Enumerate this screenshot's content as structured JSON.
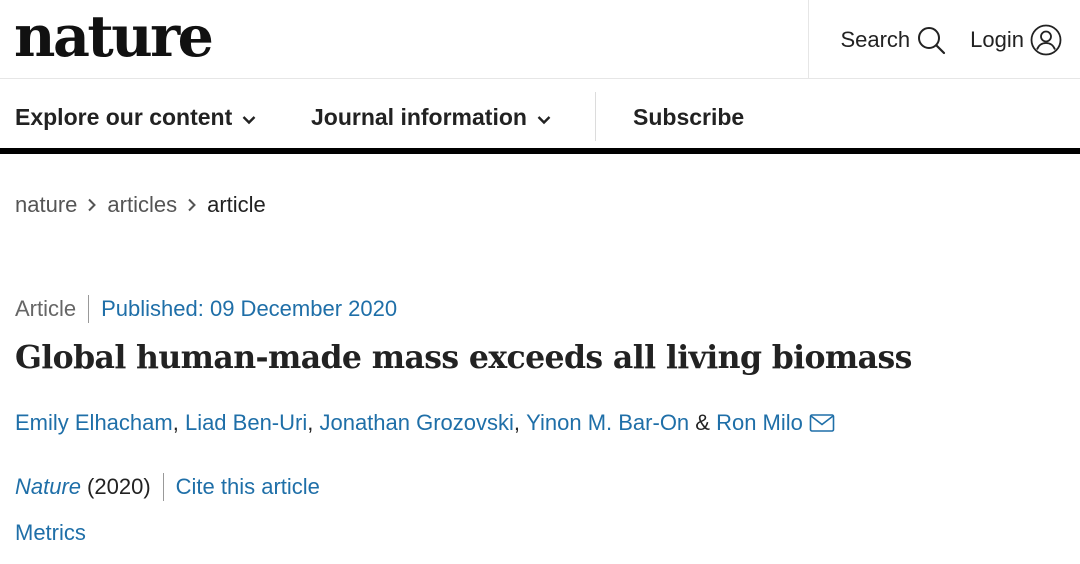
{
  "header": {
    "logo": "nature",
    "search_label": "Search",
    "login_label": "Login"
  },
  "nav": {
    "items": [
      {
        "label": "Explore our content",
        "dropdown": true
      },
      {
        "label": "Journal information",
        "dropdown": true
      },
      {
        "label": "Subscribe",
        "dropdown": false
      }
    ]
  },
  "breadcrumb": {
    "items": [
      "nature",
      "articles",
      "article"
    ]
  },
  "article": {
    "type": "Article",
    "published": "Published: 09 December 2020",
    "title": "Global human-made mass exceeds all living biomass",
    "authors": [
      "Emily Elhacham",
      "Liad Ben-Uri",
      "Jonathan Grozovski",
      "Yinon M. Bar-On",
      "Ron Milo"
    ],
    "author_sep": ", ",
    "author_last_sep": " & ",
    "journal": "Nature",
    "year": "(2020)",
    "cite_label": "Cite this article",
    "metrics_label": "Metrics"
  },
  "colors": {
    "link": "#1f6fa8",
    "text": "#222222",
    "nav_rule": "#000000"
  },
  "icons": {
    "search": "search-icon",
    "login": "user-circle-icon",
    "dropdown": "chevron-down-icon",
    "breadcrumb_sep": "chevron-right-icon",
    "mail": "envelope-icon"
  }
}
